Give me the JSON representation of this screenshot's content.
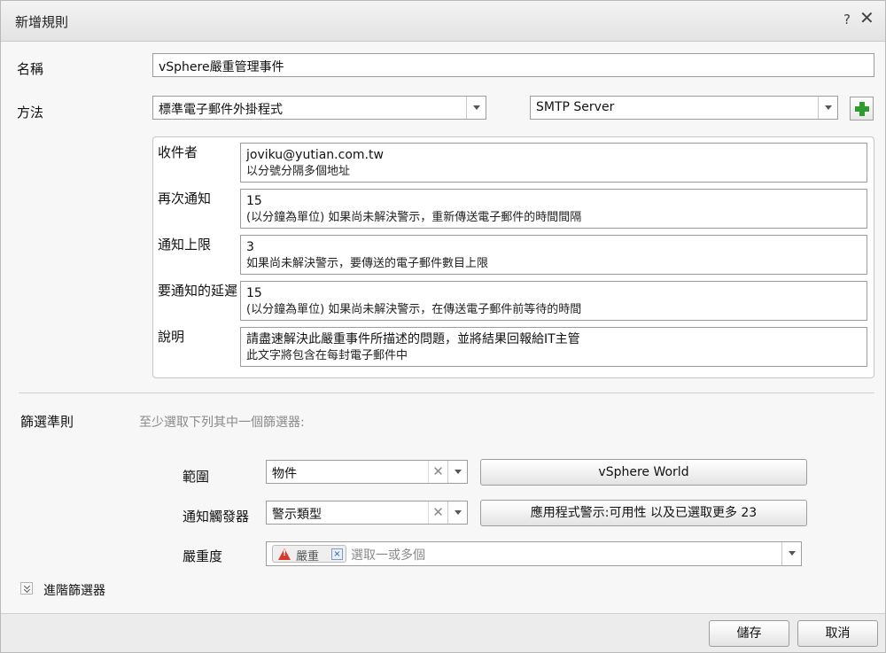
{
  "dialog": {
    "title": "新增規則",
    "help": "?",
    "close": "✕"
  },
  "name": {
    "label": "名稱",
    "value": "vSphere嚴重管理事件"
  },
  "method": {
    "label": "方法",
    "plugin_value": "標準電子郵件外掛程式",
    "server_value": "SMTP Server"
  },
  "fields": [
    {
      "label": "收件者",
      "value": "joviku@yutian.com.tw",
      "hint": "以分號分隔多個地址"
    },
    {
      "label": "再次通知",
      "value": "15",
      "hint": "(以分鐘為單位) 如果尚未解決警示，重新傳送電子郵件的時間間隔"
    },
    {
      "label": "通知上限",
      "value": "3",
      "hint": "如果尚未解決警示，要傳送的電子郵件數目上限"
    },
    {
      "label": "要通知的延遲",
      "value": "15",
      "hint": "(以分鐘為單位) 如果尚未解決警示，在傳送電子郵件前等待的時間"
    },
    {
      "label": "說明",
      "value": "請盡速解決此嚴重事件所描述的問題，並將結果回報給IT主管",
      "hint": "此文字將包含在每封電子郵件中"
    }
  ],
  "filter": {
    "label": "篩選準則",
    "hint": "至少選取下列其中一個篩選器:",
    "scope": {
      "label": "範圍",
      "value": "物件",
      "button": "vSphere World"
    },
    "trigger": {
      "label": "通知觸發器",
      "value": "警示類型",
      "button": "應用程式警示:可用性 以及已選取更多 23"
    },
    "severity": {
      "label": "嚴重度",
      "chip": "嚴重",
      "placeholder": "選取一或多個"
    },
    "advanced": "進階篩選器"
  },
  "footer": {
    "save": "儲存",
    "cancel": "取消"
  },
  "colors": {
    "add_green": "#2d9b2d",
    "warning_red": "#d63a2f"
  }
}
